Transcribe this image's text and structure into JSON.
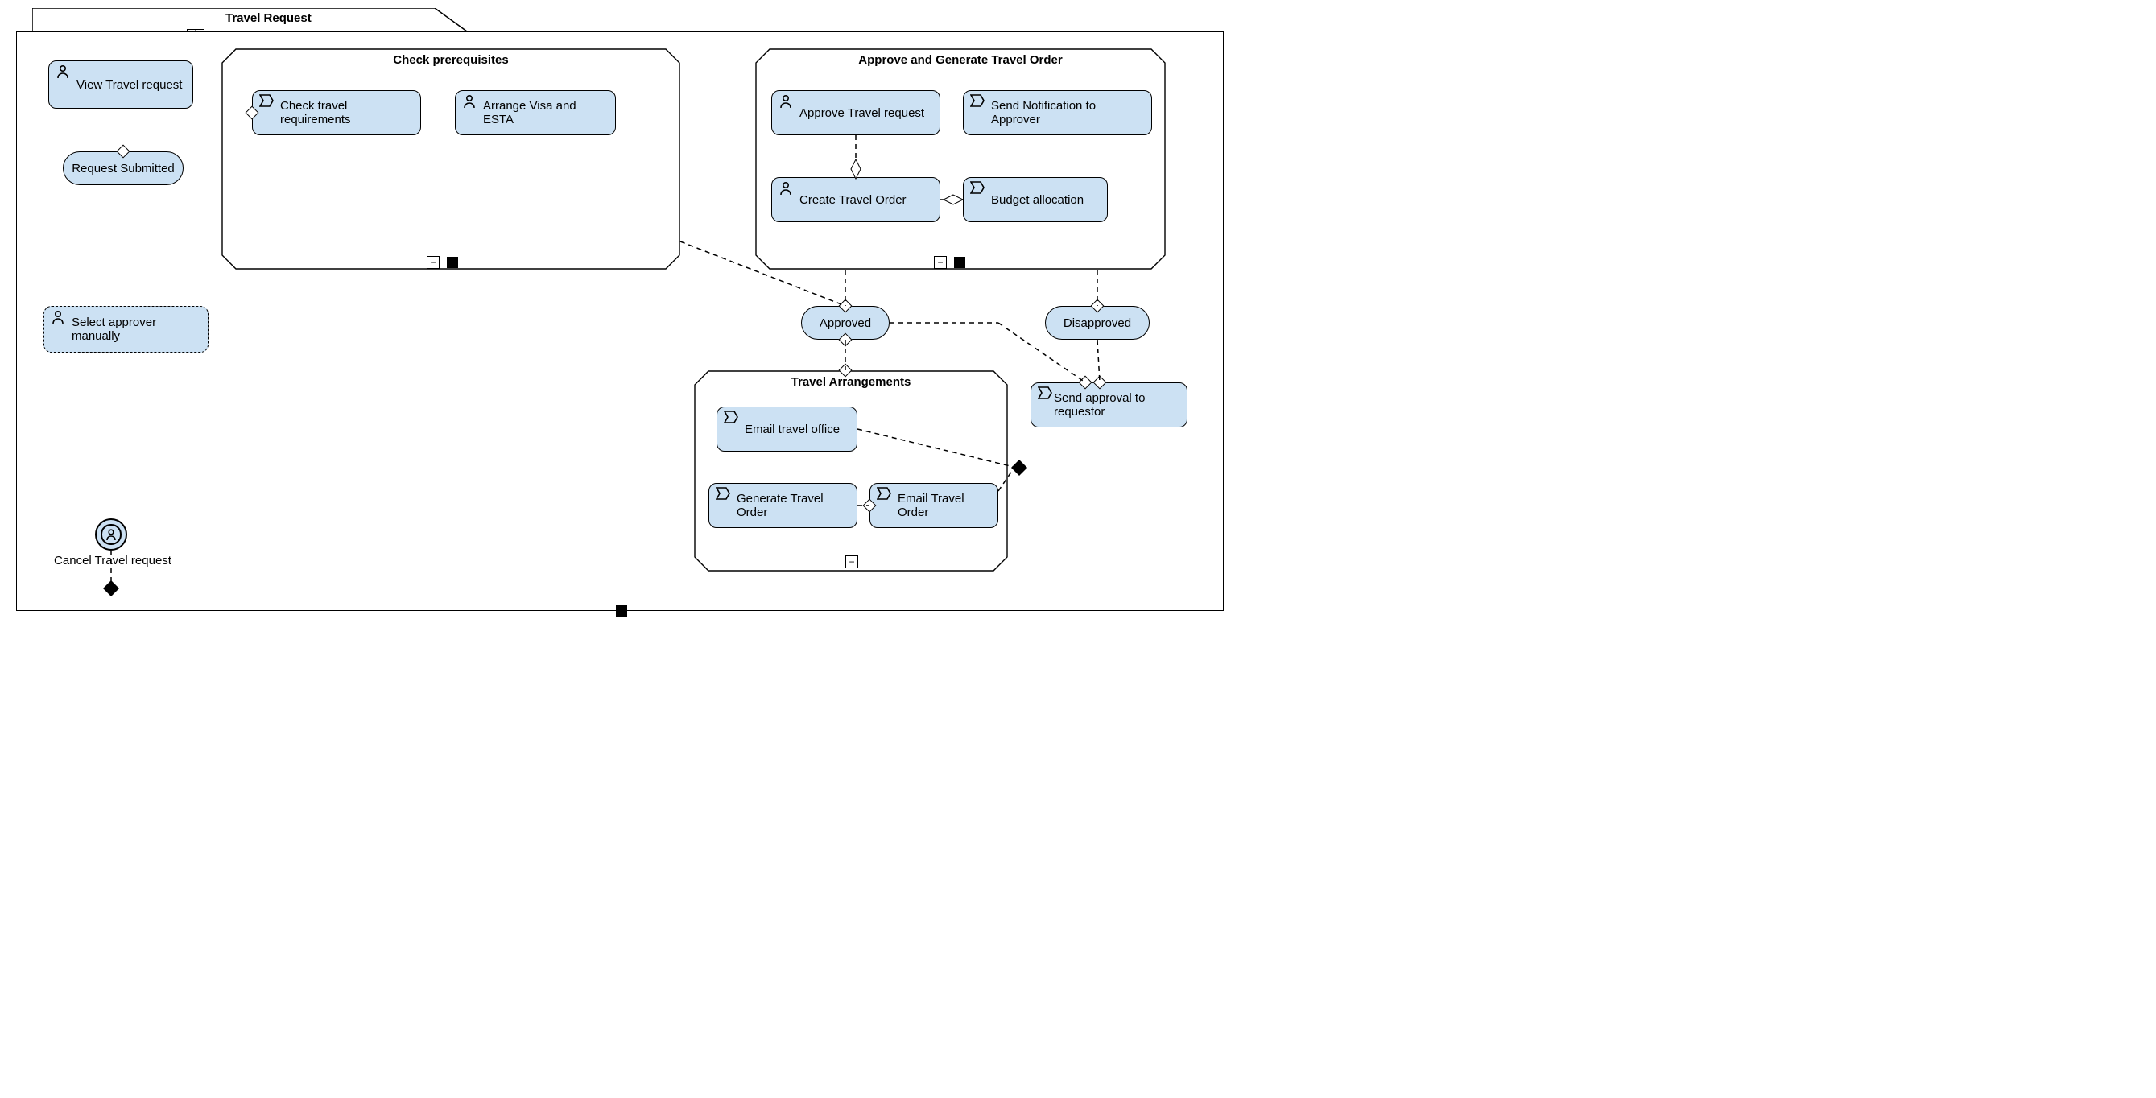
{
  "frame": {
    "title": "Travel Request"
  },
  "left": {
    "view_label": "View Travel request",
    "submitted_label": "Request Submitted",
    "select_approver_label": "Select approver manually",
    "cancel_label": "Cancel Travel request"
  },
  "prereq": {
    "title": "Check prerequisites",
    "check_req_label": "Check travel requirements",
    "arrange_visa_label": "Arrange Visa and ESTA"
  },
  "approve_region": {
    "title": "Approve and Generate Travel Order",
    "approve_label": "Approve Travel request",
    "notify_label": "Send Notification to Approver",
    "create_order_label": "Create Travel Order",
    "budget_label": "Budget allocation"
  },
  "states": {
    "approved_label": "Approved",
    "disapproved_label": "Disapproved"
  },
  "arrangements": {
    "title": "Travel Arrangements",
    "email_office_label": "Email travel office",
    "generate_label": "Generate Travel Order",
    "email_order_label": "Email Travel Order"
  },
  "send_approval": {
    "label": "Send approval to requestor"
  },
  "icons": {
    "user": "user-icon",
    "send": "send-icon",
    "grid": "grid-icon",
    "collapse": "collapse-icon"
  }
}
